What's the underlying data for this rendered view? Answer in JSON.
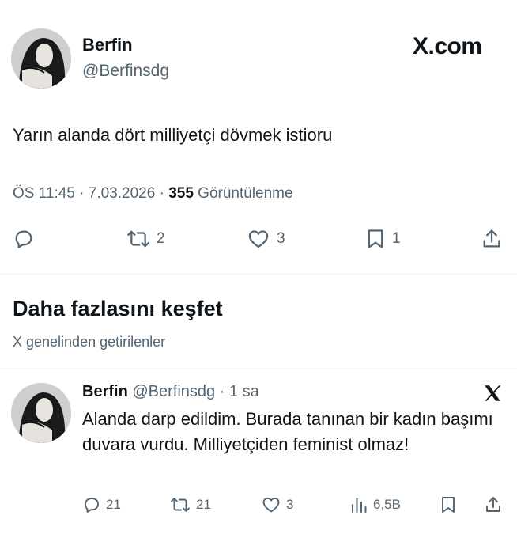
{
  "tweet": {
    "author_name": "Berfin",
    "author_handle": "@Berfinsdg",
    "brand": "X.com",
    "text": "Yarın alanda dört milliyetçi dövmek istioru",
    "time": "ÖS 11:45",
    "date": "7.03.2026",
    "views_count": "355",
    "views_label": "Görüntülenme",
    "actions": {
      "reply_count": "",
      "retweet_count": "2",
      "like_count": "3",
      "bookmark_count": "1"
    }
  },
  "discover": {
    "title": "Daha fazlasını keşfet",
    "subtitle": "X genelinden getirilenler"
  },
  "recommended": {
    "author_name": "Berfin",
    "author_handle": "@Berfinsdg",
    "time_ago": "1 sa",
    "text": "Alanda darp edildim. Burada tanınan bir kadın başımı duvara vurdu. Milliyetçiden feminist olmaz!",
    "actions": {
      "reply_count": "21",
      "retweet_count": "21",
      "like_count": "3",
      "views_count": "6,5B"
    }
  },
  "colors": {
    "text_primary": "#0f1419",
    "text_secondary": "#536471",
    "divider": "#eff3f4"
  }
}
